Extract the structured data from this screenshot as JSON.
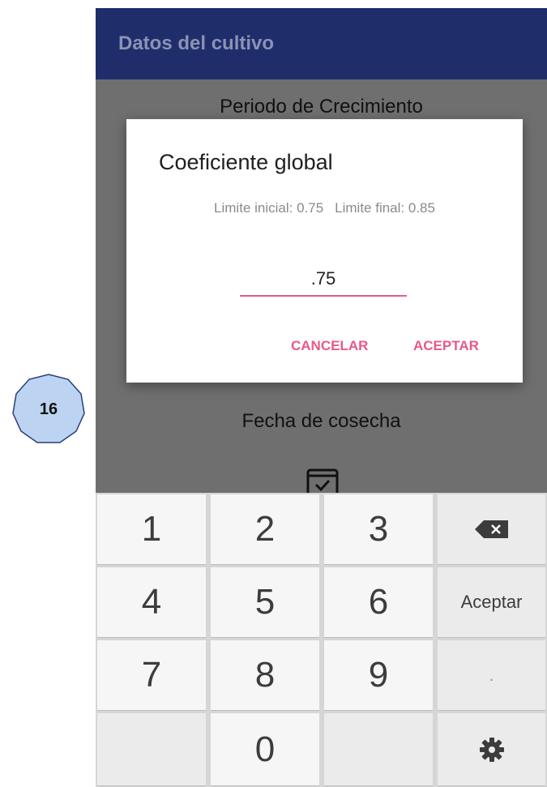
{
  "badge": {
    "number": "16"
  },
  "appbar": {
    "title": "Datos del cultivo"
  },
  "screen": {
    "label_growth_period": "Periodo de Crecimiento",
    "label_harvest_date": "Fecha de cosecha"
  },
  "dialog": {
    "title": "Coeficiente global",
    "limit_initial": "Limite inicial: 0.75",
    "limit_final": "Limite final: 0.85",
    "input_value": ".75",
    "cancel_label": "CANCELAR",
    "accept_label": "ACEPTAR"
  },
  "keyboard": {
    "k1": "1",
    "k2": "2",
    "k3": "3",
    "k4": "4",
    "k5": "5",
    "k6": "6",
    "k7": "7",
    "k8": "8",
    "k9": "9",
    "k0": "0",
    "accept": "Aceptar",
    "dot": ".",
    "backspace_icon": "backspace-icon",
    "settings_icon": "gear-icon"
  },
  "colors": {
    "appbar": "#1f2d6b",
    "accent": "#e8588c",
    "scrim": "#6f6f6f",
    "badge_fill": "#bcd3f2"
  }
}
